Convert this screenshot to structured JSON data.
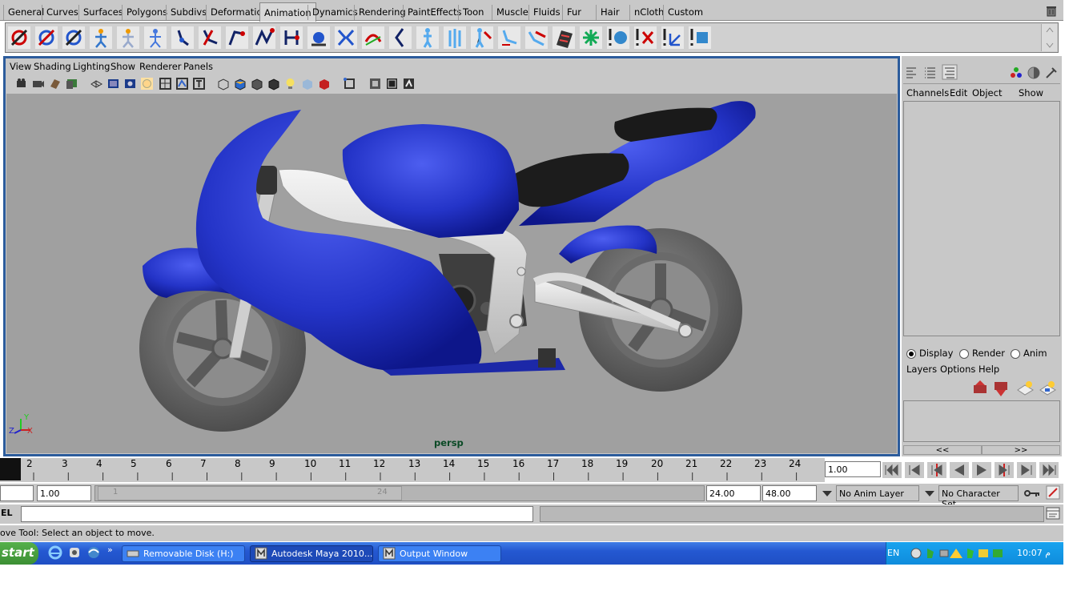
{
  "shelf_tabs": [
    "General",
    "Curves",
    "Surfaces",
    "Polygons",
    "Subdivs",
    "Deformation",
    "Animation",
    "Dynamics",
    "Rendering",
    "PaintEffects",
    "Toon",
    "Muscle",
    "Fluids",
    "Fur",
    "Hair",
    "nCloth",
    "Custom"
  ],
  "active_shelf_tab": "Animation",
  "viewport": {
    "menu": [
      "View",
      "Shading",
      "Lighting",
      "Show",
      "Renderer",
      "Panels"
    ],
    "camera_label": "persp",
    "axis_labels": {
      "y": "Y",
      "z": "Z",
      "x": "X"
    }
  },
  "channel_box": {
    "menu": [
      "Channels",
      "Edit",
      "Object",
      "Show"
    ]
  },
  "layer_editor": {
    "modes": [
      "Display",
      "Render",
      "Anim"
    ],
    "selected_mode": "Display",
    "menu": [
      "Layers",
      "Options",
      "Help"
    ],
    "collapse_left": "<<",
    "collapse_right": ">>"
  },
  "time_slider": {
    "frames": [
      "2",
      "3",
      "4",
      "5",
      "6",
      "7",
      "8",
      "9",
      "10",
      "11",
      "12",
      "13",
      "14",
      "15",
      "16",
      "17",
      "18",
      "19",
      "20",
      "21",
      "22",
      "23",
      "24"
    ],
    "current_time": "1.00"
  },
  "range_slider": {
    "start_time": "1.00",
    "range_start": "1",
    "range_end": "24",
    "end_time": "24.00",
    "playback_end": "48.00",
    "anim_layer": "No Anim Layer",
    "character_set": "No Character Set"
  },
  "command_line": {
    "label": "EL"
  },
  "help_line": "ove Tool: Select an object to move.",
  "taskbar": {
    "start_label": "start",
    "buttons": [
      "Removable Disk (H:)",
      "Autodesk Maya 2010...",
      "Output Window"
    ],
    "language": "EN",
    "clock": "10:07 م"
  },
  "colors": {
    "panel_gray": "#c8c8c8",
    "viewport_bg": "#a0a0a0",
    "active_panel_border": "#2c5c9c",
    "bike_blue": "#1f2fbf"
  }
}
